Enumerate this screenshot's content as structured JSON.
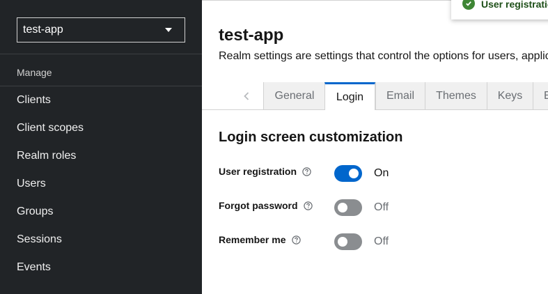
{
  "sidebar": {
    "realm_selector": {
      "value": "test-app"
    },
    "group_title": "Manage",
    "items": [
      {
        "label": "Clients"
      },
      {
        "label": "Client scopes"
      },
      {
        "label": "Realm roles"
      },
      {
        "label": "Users"
      },
      {
        "label": "Groups"
      },
      {
        "label": "Sessions"
      },
      {
        "label": "Events"
      }
    ]
  },
  "main": {
    "title": "test-app",
    "description": "Realm settings are settings that control the options for users, applic",
    "tabs": [
      {
        "label": "General"
      },
      {
        "label": "Login"
      },
      {
        "label": "Email"
      },
      {
        "label": "Themes"
      },
      {
        "label": "Keys"
      },
      {
        "label": "E"
      }
    ],
    "active_tab": "Login",
    "section_title": "Login screen customization",
    "fields": [
      {
        "label": "User registration",
        "state": "On",
        "enabled": true
      },
      {
        "label": "Forgot password",
        "state": "Off",
        "enabled": false
      },
      {
        "label": "Remember me",
        "state": "Off",
        "enabled": false
      }
    ]
  },
  "toast": {
    "text": "User registration"
  },
  "colors": {
    "sidebar_bg": "#212427",
    "accent": "#0066cc",
    "switch_off": "#8a8d90",
    "success": "#3e8635"
  }
}
